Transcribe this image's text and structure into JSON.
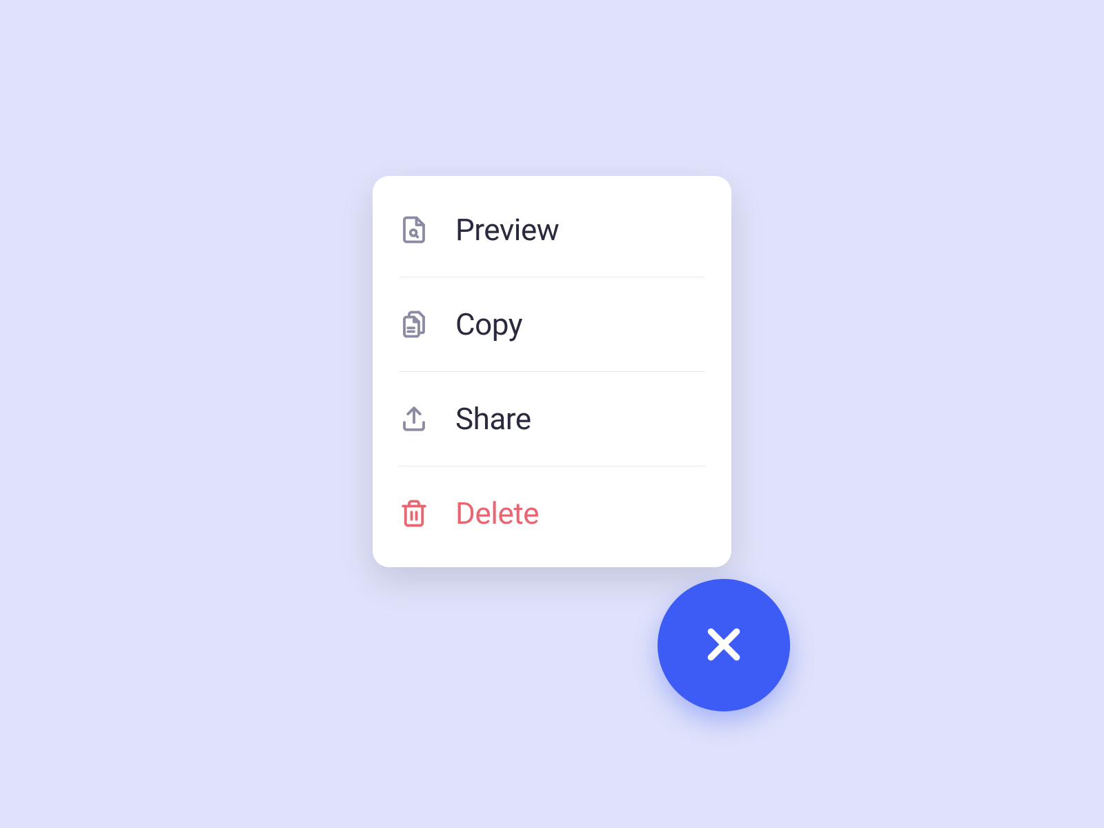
{
  "menu": {
    "items": [
      {
        "id": "preview",
        "label": "Preview",
        "icon": "file-search-icon",
        "danger": false
      },
      {
        "id": "copy",
        "label": "Copy",
        "icon": "file-copy-icon",
        "danger": false
      },
      {
        "id": "share",
        "label": "Share",
        "icon": "upload-icon",
        "danger": false
      },
      {
        "id": "delete",
        "label": "Delete",
        "icon": "trash-icon",
        "danger": true
      }
    ]
  },
  "colors": {
    "background": "#dfe2fa",
    "card": "#ffffff",
    "text_primary": "#2a2a3f",
    "icon_default": "#8b8ba3",
    "danger": "#e86571",
    "accent": "#3c5cf5",
    "divider": "#e8e8ef"
  }
}
